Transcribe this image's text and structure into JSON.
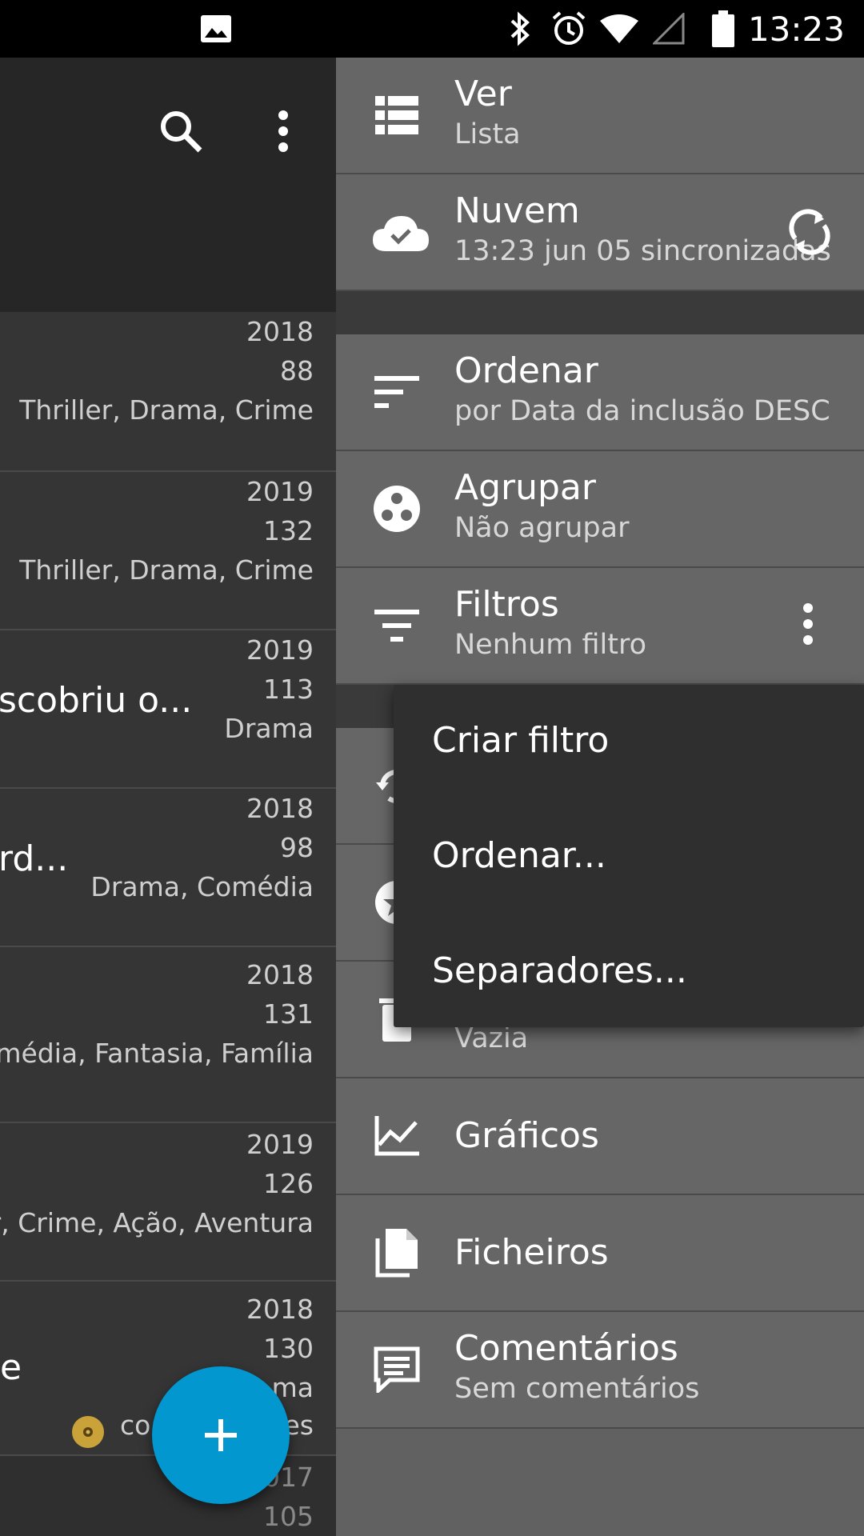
{
  "status_bar": {
    "time": "13:23"
  },
  "list": {
    "rows": [
      {
        "year": "2018",
        "duration": "88",
        "genres": "Thriller, Drama, Crime",
        "title": ""
      },
      {
        "year": "2019",
        "duration": "132",
        "genres": "Thriller, Drama, Crime",
        "title": ""
      },
      {
        "year": "2019",
        "duration": "113",
        "genres": "Drama",
        "title": "scobriu o..."
      },
      {
        "year": "2018",
        "duration": "98",
        "genres": "Drama, Comédia",
        "title": "rd..."
      },
      {
        "year": "2018",
        "duration": "131",
        "genres": "omédia, Fantasia, Família",
        "title": ""
      },
      {
        "year": "2019",
        "duration": "126",
        "genres": "er, Crime, Ação, Aventura",
        "title": ""
      },
      {
        "year": "2018",
        "duration": "130",
        "genres": "ma",
        "title": "e",
        "extra": "co",
        "extra_right": "es"
      },
      {
        "year": "017",
        "duration": "105",
        "genres": "",
        "title": ""
      }
    ]
  },
  "drawer": {
    "view": {
      "label": "Ver",
      "value": "Lista"
    },
    "cloud": {
      "label": "Nuvem",
      "value": "13:23 jun 05 sincronizadas"
    },
    "sort": {
      "label": "Ordenar",
      "value": "por Data da inclusão DESC"
    },
    "group": {
      "label": "Agrupar",
      "value": "Não agrupar"
    },
    "filters": {
      "label": "Filtros",
      "value": "Nenhum filtro"
    },
    "trash": {
      "value": "Vazia"
    },
    "charts": {
      "label": "Gráficos"
    },
    "files": {
      "label": "Ficheiros"
    },
    "comments": {
      "label": "Comentários",
      "value": "Sem comentários"
    }
  },
  "popup_menu": {
    "items": [
      "Criar filtro",
      "Ordenar...",
      "Separadores..."
    ]
  },
  "colors": {
    "fab": "#0297cf",
    "drawer": "#616161",
    "popup": "#2f2f2f"
  }
}
